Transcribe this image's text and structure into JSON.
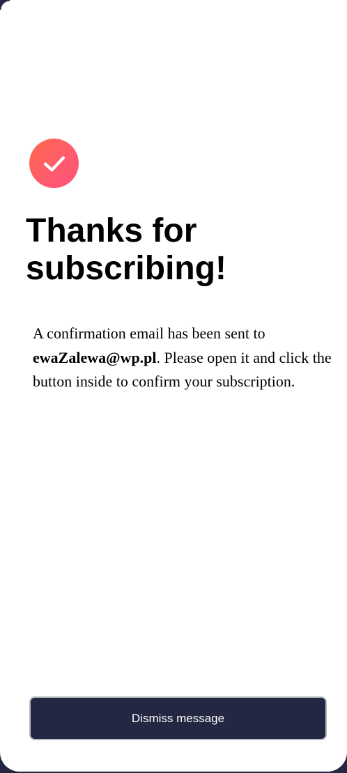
{
  "confirmation": {
    "icon": "check-icon",
    "title": "Thanks for subscribing!",
    "message_prefix": "A confirmation email has been sent to ",
    "email": "ewaZalewa@wp.pl",
    "message_suffix": ". Please open it and click the button inside to confirm your subscription.",
    "dismiss_label": "Dismiss message"
  },
  "colors": {
    "background": "#242742",
    "card": "#ffffff",
    "badge_gradient_start": "#ff6a4d",
    "badge_gradient_end": "#ff527b",
    "button": "#242742",
    "button_text": "#ffffff"
  }
}
